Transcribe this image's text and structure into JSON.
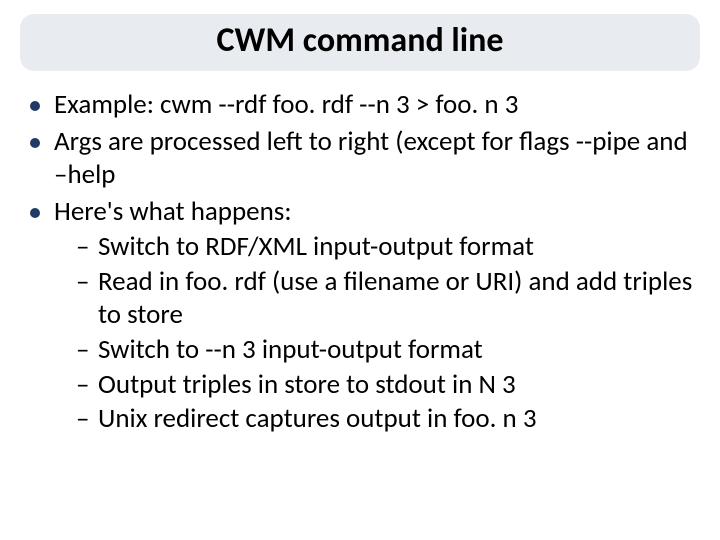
{
  "title": "CWM command line",
  "bullets": [
    {
      "text": "Example: cwm --rdf foo. rdf --n 3  > foo. n 3"
    },
    {
      "text": "Args are processed left to right (except for flags --pipe and –help"
    },
    {
      "text": "Here's what happens:",
      "sub": [
        "Switch to RDF/XML input-output format",
        "Read in foo. rdf (use a filename or URI) and add triples to store",
        "Switch to --n 3 input-output format",
        "Output triples in store to stdout in N 3",
        "Unix redirect captures output in foo. n 3"
      ]
    }
  ]
}
